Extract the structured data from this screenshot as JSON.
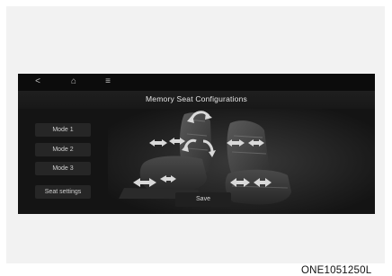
{
  "topbar": {
    "back_icon": "<",
    "home_icon": "⌂",
    "menu_icon": "≡"
  },
  "screen": {
    "title": "Memory Seat Configurations"
  },
  "modes": [
    {
      "label": "Mode 1"
    },
    {
      "label": "Mode 2"
    },
    {
      "label": "Mode 3"
    },
    {
      "label": "Seat settings"
    }
  ],
  "save_label": "Save",
  "image_code": "ONE1051250L",
  "icons": {
    "back": "back-icon",
    "home": "home-icon",
    "menu": "menu-icon",
    "adjust_arrows": "double-arrow-icon",
    "recline_arrows": "curved-arrow-icon"
  },
  "colors": {
    "screen_bg": "#141414",
    "button_bg": "#262626",
    "arrow": "#d9d9d9"
  }
}
